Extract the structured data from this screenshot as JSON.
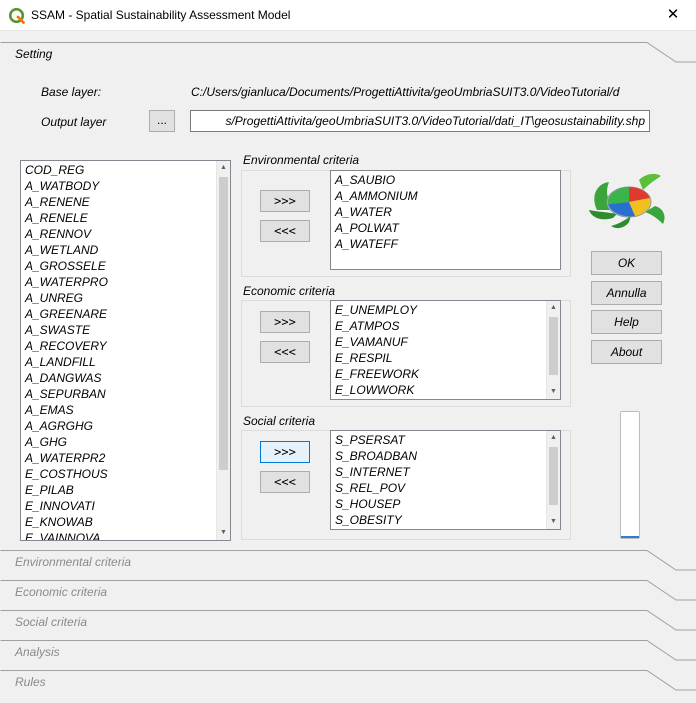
{
  "window": {
    "title": "SSAM - Spatial Sustainability Assessment Model",
    "close_glyph": "✕"
  },
  "sections": {
    "setting": "Setting",
    "collapsed": [
      "Environmental criteria",
      "Economic criteria",
      "Social criteria",
      "Analysis",
      "Rules"
    ]
  },
  "setting": {
    "base_layer_label": "Base layer:",
    "base_layer_value": "C:/Users/gianluca/Documents/ProgettiAttivita/geoUmbriaSUIT3.0/VideoTutorial/d",
    "output_layer_label": "Output layer",
    "browse_label": "...",
    "output_layer_value": "s/ProgettiAttivita/geoUmbriaSUIT3.0/VideoTutorial/dati_IT\\geosustainability.shp"
  },
  "fields_list": [
    "COD_REG",
    "A_WATBODY",
    "A_RENENE",
    "A_RENELE",
    "A_RENNOV",
    "A_WETLAND",
    "A_GROSSELE",
    "A_WATERPRO",
    "A_UNREG",
    "A_GREENARE",
    "A_SWASTE",
    "A_RECOVERY",
    "A_LANDFILL",
    "A_DANGWAS",
    "A_SEPURBAN",
    "A_EMAS",
    "A_AGRGHG",
    "A_GHG",
    "A_WATERPR2",
    "E_COSTHOUS",
    "E_PILAB",
    "E_INNOVATI",
    "E_KNOWAB",
    "E_VAINNOVA"
  ],
  "groups": {
    "environmental": {
      "title": "Environmental criteria",
      "add_label": ">>>",
      "remove_label": "<<<",
      "items": [
        "A_SAUBIO",
        "A_AMMONIUM",
        "A_WATER",
        "A_POLWAT",
        "A_WATEFF"
      ]
    },
    "economic": {
      "title": "Economic criteria",
      "add_label": ">>>",
      "remove_label": "<<<",
      "items": [
        "E_UNEMPLOY",
        "E_ATMPOS",
        "E_VAMANUF",
        "E_RESPIL",
        "E_FREEWORK",
        "E_LOWWORK"
      ]
    },
    "social": {
      "title": "Social criteria",
      "add_label": ">>>",
      "remove_label": "<<<",
      "items": [
        "S_PSERSAT",
        "S_BROADBAN",
        "S_INTERNET",
        "S_REL_POV",
        "S_HOUSEP",
        "S_OBESITY"
      ]
    }
  },
  "buttons": {
    "ok": "OK",
    "cancel": "Annulla",
    "help": "Help",
    "about": "About"
  },
  "progress": {
    "value_fraction": 0
  },
  "colors": {
    "progress_accent": "#2a7fd4",
    "logo_green": "#3aa53a",
    "qgis_green": "#589632"
  }
}
